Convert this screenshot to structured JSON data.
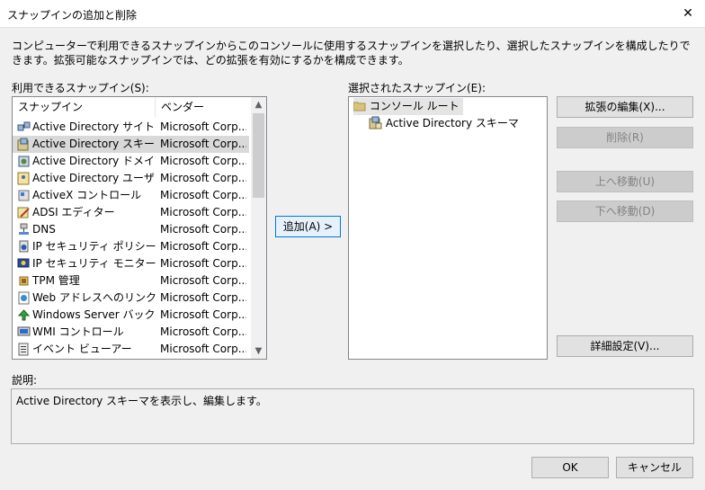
{
  "window": {
    "title": "スナップインの追加と削除",
    "close_glyph": "✕"
  },
  "description_text": "コンピューターで利用できるスナップインからこのコンソールに使用するスナップインを選択したり、選択したスナップインを構成したりできます。拡張可能なスナップインでは、どの拡張を有効にするかを構成できます。",
  "available": {
    "label": "利用できるスナップイン(S):",
    "col_name": "スナップイン",
    "col_vendor": "ベンダー",
    "items": [
      {
        "name": "Active Directory サイトと…",
        "vendor": "Microsoft Corp...",
        "icon": "ad-sites-icon"
      },
      {
        "name": "Active Directory スキーマ",
        "vendor": "Microsoft Corp...",
        "icon": "ad-schema-icon"
      },
      {
        "name": "Active Directory ドメイン…",
        "vendor": "Microsoft Corp...",
        "icon": "ad-domains-icon"
      },
      {
        "name": "Active Directory ユーザー…",
        "vendor": "Microsoft Corp...",
        "icon": "ad-users-icon"
      },
      {
        "name": "ActiveX コントロール",
        "vendor": "Microsoft Corp...",
        "icon": "activex-icon"
      },
      {
        "name": "ADSI エディター",
        "vendor": "Microsoft Corp...",
        "icon": "adsi-editor-icon"
      },
      {
        "name": "DNS",
        "vendor": "Microsoft Corp...",
        "icon": "dns-icon"
      },
      {
        "name": "IP セキュリティ ポリシーの管…",
        "vendor": "Microsoft Corp...",
        "icon": "ipsec-policy-icon"
      },
      {
        "name": "IP セキュリティ モニター",
        "vendor": "Microsoft Corp...",
        "icon": "ipsec-monitor-icon"
      },
      {
        "name": "TPM 管理",
        "vendor": "Microsoft Corp...",
        "icon": "tpm-icon"
      },
      {
        "name": "Web アドレスへのリンク",
        "vendor": "Microsoft Corp...",
        "icon": "web-link-icon"
      },
      {
        "name": "Windows Server バックアップ…",
        "vendor": "Microsoft Corp...",
        "icon": "backup-icon"
      },
      {
        "name": "WMI コントロール",
        "vendor": "Microsoft Corp...",
        "icon": "wmi-icon"
      },
      {
        "name": "イベント ビューアー",
        "vendor": "Microsoft Corp...",
        "icon": "event-viewer-icon"
      }
    ],
    "selected_index": 1
  },
  "add_button": "追加(A) >",
  "selected": {
    "label": "選択されたスナップイン(E):",
    "root": "コンソール ルート",
    "child": "Active Directory スキーマ"
  },
  "buttons": {
    "edit_extensions": "拡張の編集(X)...",
    "remove": "削除(R)",
    "move_up": "上へ移動(U)",
    "move_down": "下へ移動(D)",
    "advanced": "詳細設定(V)...",
    "ok": "OK",
    "cancel": "キャンセル"
  },
  "explanation": {
    "label": "説明:",
    "text": "Active Directory スキーマを表示し、編集します。"
  }
}
